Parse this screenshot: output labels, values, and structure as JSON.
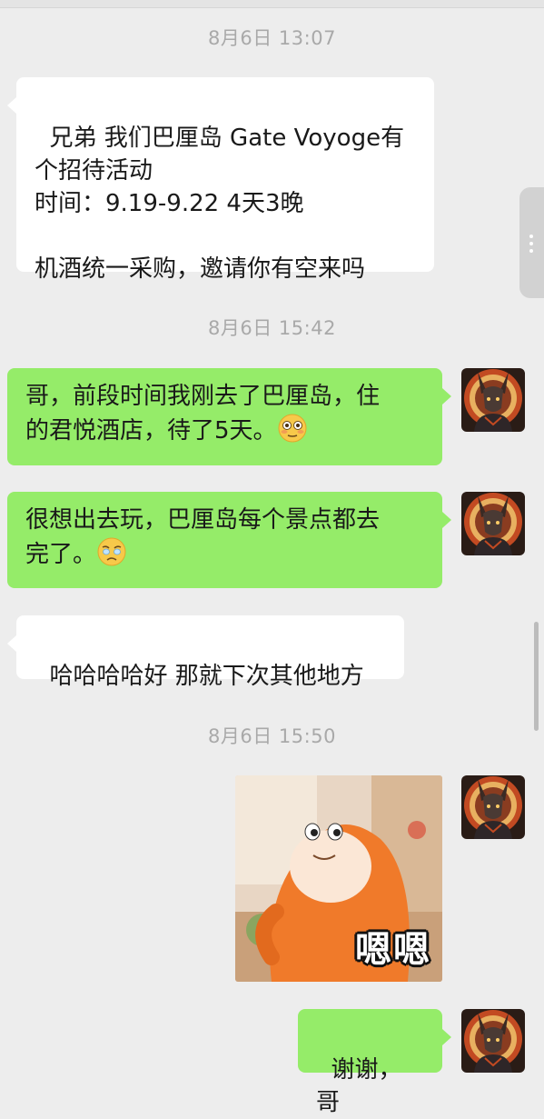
{
  "chat": {
    "timestamps": [
      "8月6日 13:07",
      "8月6日 15:42",
      "8月6日 15:50"
    ],
    "messages": {
      "m1": "兄弟 我们巴厘岛 Gate Voyoge有\n个招待活动\n时间：9.19-9.22 4天3晚\n\n机酒统一采购，邀请你有空来吗",
      "m2": "哥，前段时间我刚去了巴厘岛，住\n的君悦酒店，待了5天。",
      "m3": "很想出去玩，巴厘岛每个景点都去\n完了。",
      "m4": "哈哈哈哈好 那就下次其他地方",
      "m5": "谢谢，哥"
    },
    "sticker_caption": "嗯嗯"
  },
  "icons": {
    "m2_emoji": "flushed-face-emoji",
    "m3_emoji": "face-holding-back-tears-emoji",
    "avatar": "fox-warrior-avatar",
    "side_handle": "more-dots-icon"
  },
  "colors": {
    "background": "#ededed",
    "incoming_bubble": "#ffffff",
    "outgoing_bubble": "#95ec69",
    "timestamp_text": "#a9a9a9"
  }
}
